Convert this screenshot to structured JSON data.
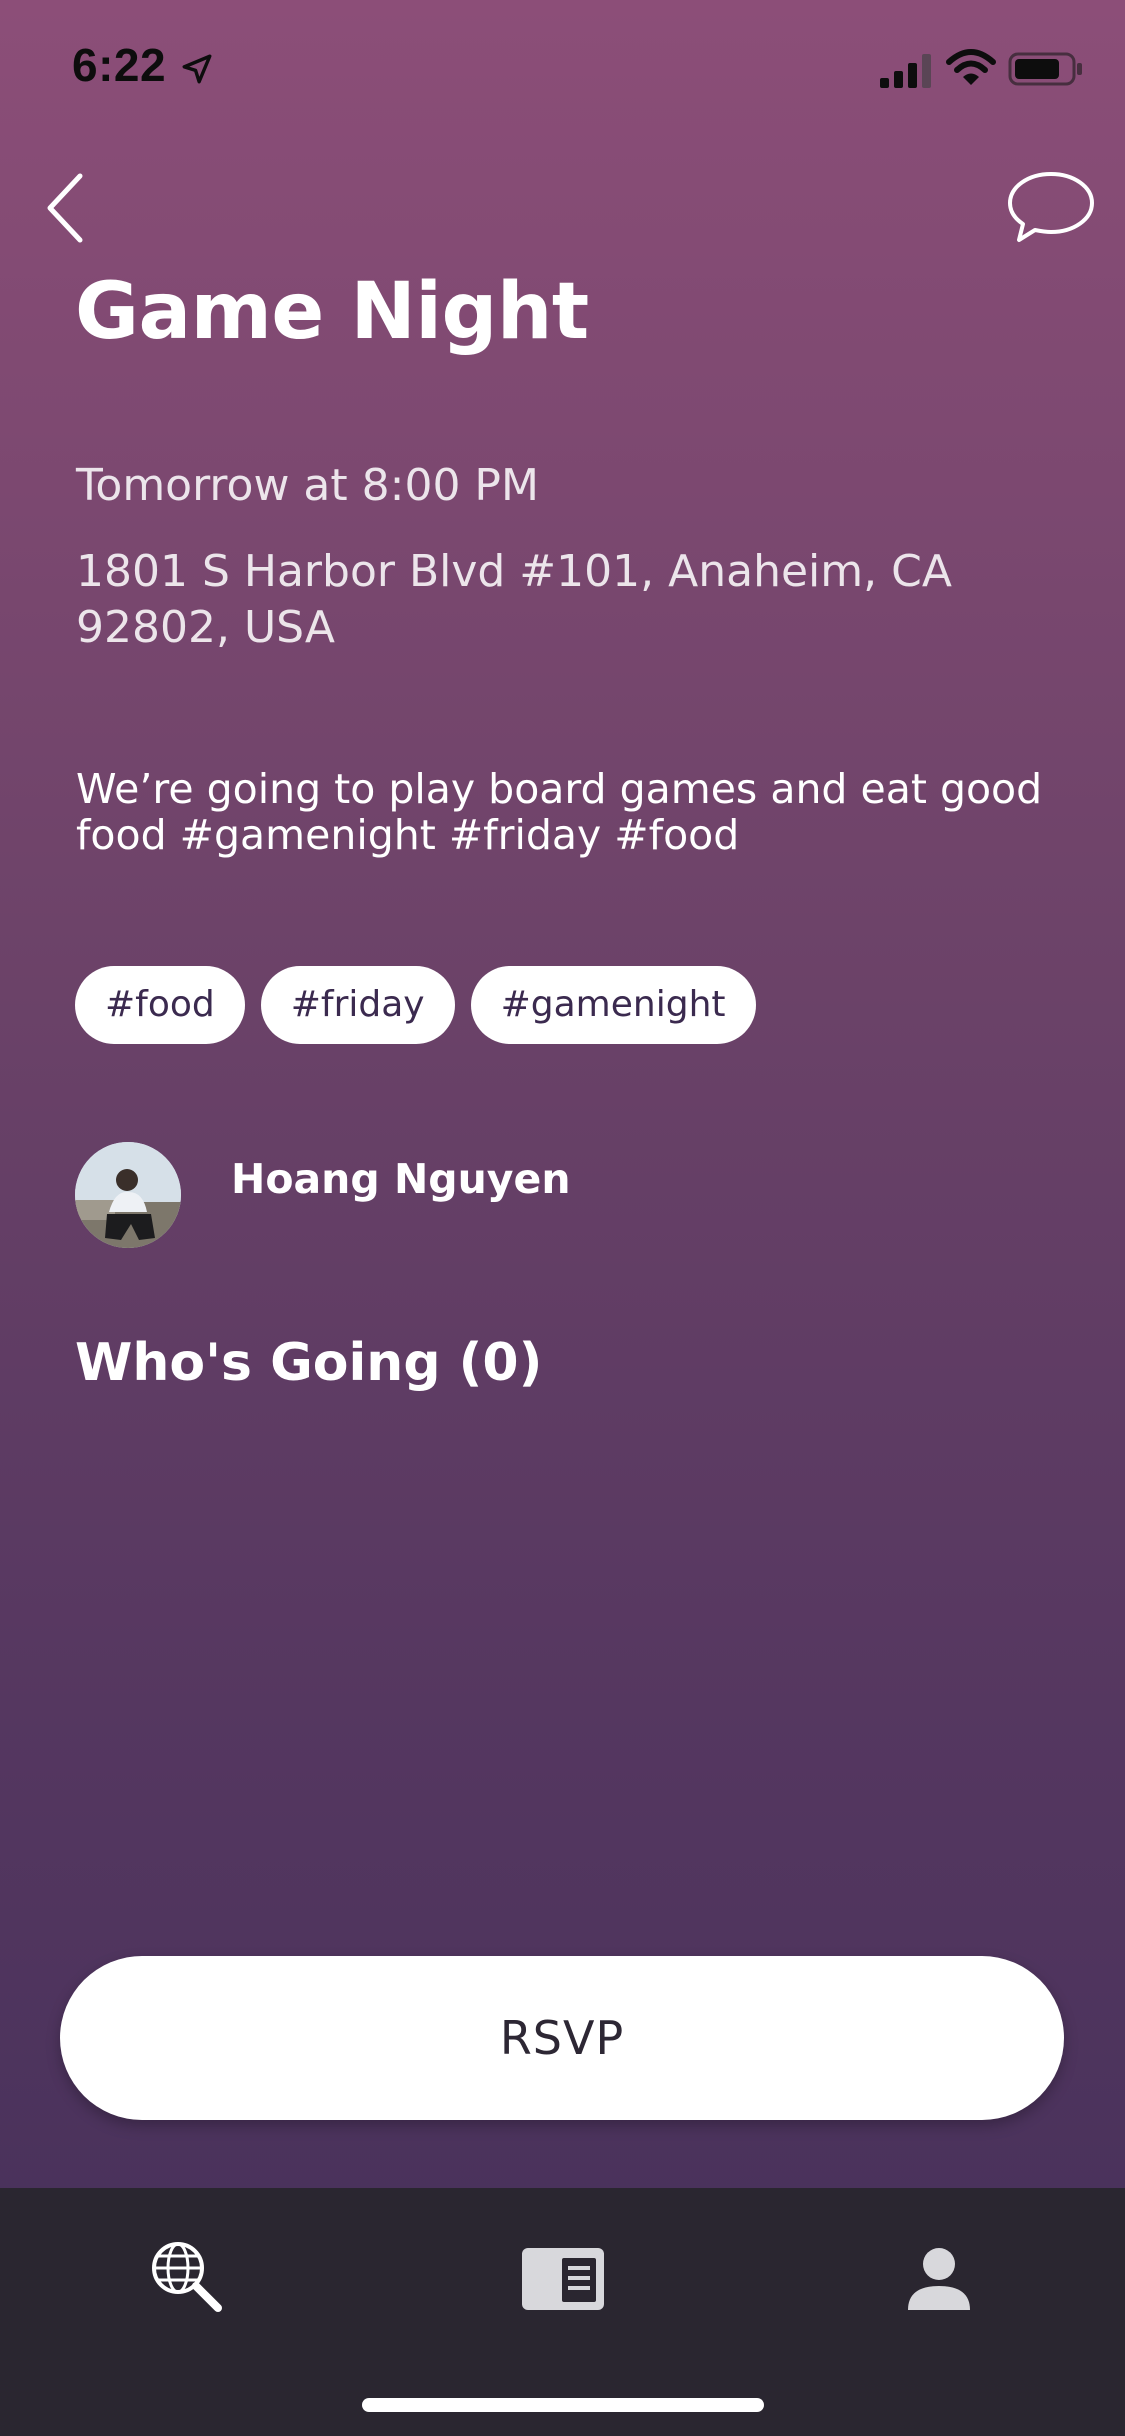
{
  "status_bar": {
    "time": "6:22",
    "icons": [
      "location-arrow-icon",
      "cellular-signal-icon",
      "wifi-icon",
      "battery-icon"
    ]
  },
  "nav": {
    "back_icon": "chevron-left-icon",
    "chat_icon": "chat-bubble-icon"
  },
  "event": {
    "title": "Game Night",
    "time": "Tomorrow at 8:00 PM",
    "address": "1801 S Harbor Blvd #101, Anaheim, CA 92802, USA",
    "description": "We’re going to play board games and eat good food #gamenight #friday #food",
    "tags": [
      "#food",
      "#friday",
      "#gamenight"
    ]
  },
  "host": {
    "name": "Hoang Nguyen"
  },
  "attendees": {
    "heading": "Who's Going (0)"
  },
  "actions": {
    "rsvp_label": "RSVP"
  },
  "tab_bar": {
    "items": [
      {
        "icon": "globe-search-icon",
        "active": true
      },
      {
        "icon": "feed-icon",
        "active": false
      },
      {
        "icon": "profile-icon",
        "active": false
      }
    ]
  },
  "colors": {
    "gradient_top": "#8c4e78",
    "gradient_bottom": "#45305a",
    "tab_bar_bg": "#2a2630",
    "tag_text": "#3b2a4f",
    "button_bg": "#ffffff"
  }
}
